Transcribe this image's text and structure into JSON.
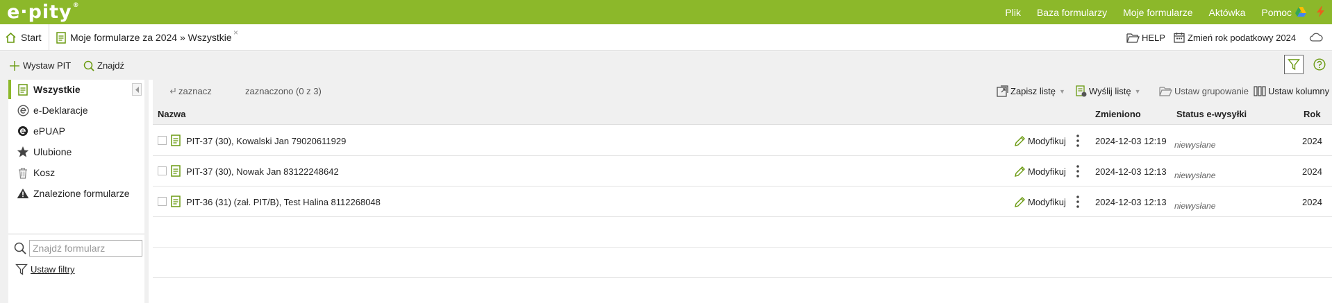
{
  "brand": {
    "logo_text": "e·pity",
    "logo_mark": "®"
  },
  "top_menu": [
    {
      "label": "Plik"
    },
    {
      "label": "Baza formularzy"
    },
    {
      "label": "Moje formularze"
    },
    {
      "label": "Aktówka"
    },
    {
      "label": "Pomoc"
    }
  ],
  "top_icons": [
    "google-drive-icon",
    "lightning-icon"
  ],
  "tabs": {
    "start_label": "Start",
    "active_label": "Moje formularze za 2024 » Wszystkie",
    "close_glyph": "×"
  },
  "tabs_right": {
    "help_label": "HELP",
    "change_year_label": "Zmień rok podatkowy 2024"
  },
  "toolbar": {
    "issue_pit_label": "Wystaw PIT",
    "find_label": "Znajdź"
  },
  "sidebar": {
    "items": [
      {
        "label": "Wszystkie",
        "icon": "document-icon",
        "active": true
      },
      {
        "label": "e-Deklaracje",
        "icon": "e-declaration-icon",
        "active": false
      },
      {
        "label": "ePUAP",
        "icon": "epuap-icon",
        "active": false
      },
      {
        "label": "Ulubione",
        "icon": "star-icon",
        "active": false
      },
      {
        "label": "Kosz",
        "icon": "trash-icon",
        "active": false
      },
      {
        "label": "Znalezione formularze",
        "icon": "warning-icon",
        "active": false
      }
    ],
    "search_placeholder": "Znajdź formularz",
    "filters_label": "Ustaw filtry"
  },
  "list_toolbar": {
    "select_label": "zaznacz",
    "selected_count": "zaznaczono (0 z 3)",
    "save_list_label": "Zapisz listę",
    "send_list_label": "Wyślij listę",
    "grouping_label": "Ustaw grupowanie",
    "columns_label": "Ustaw kolumny"
  },
  "table": {
    "headers": {
      "name": "Nazwa",
      "modified": "Zmieniono",
      "status": "Status e-wysyłki",
      "year": "Rok"
    },
    "rows": [
      {
        "name": "PIT-37 (30), Kowalski Jan 79020611929",
        "action": "Modyfikuj",
        "modified": "2024-12-03 12:19",
        "status": "niewysłane",
        "year": "2024"
      },
      {
        "name": "PIT-37 (30), Nowak Jan 83122248642",
        "action": "Modyfikuj",
        "modified": "2024-12-03 12:13",
        "status": "niewysłane",
        "year": "2024"
      },
      {
        "name": "PIT-36 (31) (zał. PIT/B), Test Halina 8112268048",
        "action": "Modyfikuj",
        "modified": "2024-12-03 12:13",
        "status": "niewysłane",
        "year": "2024"
      }
    ]
  },
  "colors": {
    "brand_green": "#8cb82a",
    "toolbar_gray": "#f0f0f0"
  }
}
